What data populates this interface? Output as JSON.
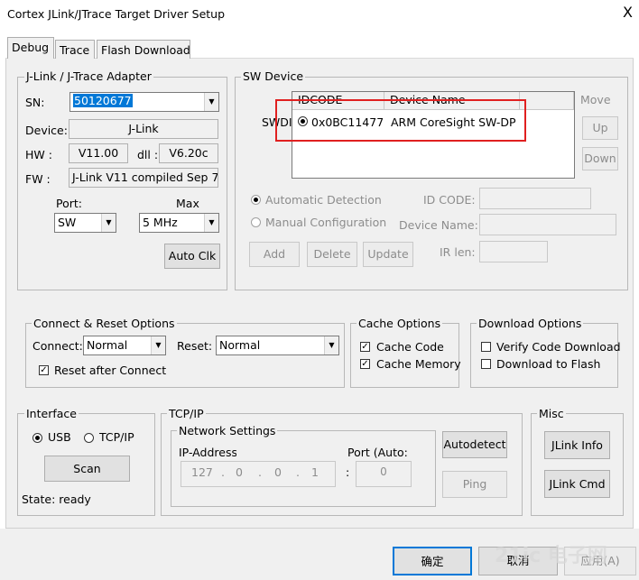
{
  "window": {
    "title": "Cortex JLink/JTrace Target Driver Setup",
    "close_glyph": "X"
  },
  "tabs": [
    "Debug",
    "Trace",
    "Flash Download"
  ],
  "adapter": {
    "title": "J-Link / J-Trace Adapter",
    "sn_label": "SN:",
    "sn_value": "50120677",
    "device_label": "Device:",
    "device_value": "J-Link",
    "hw_label": "HW :",
    "hw_value": "V11.00",
    "dll_label": "dll :",
    "dll_value": "V6.20c",
    "fw_label": "FW :",
    "fw_value": "J-Link V11 compiled Sep  7",
    "port_label": "Port:",
    "port_value": "SW",
    "max_label": "Max",
    "max_value": "5 MHz",
    "auto_clk": "Auto Clk"
  },
  "sw_device": {
    "title": "SW Device",
    "col_idcode": "IDCODE",
    "col_device_name": "Device Name",
    "row_label": "SWDI",
    "row_idcode": "0x0BC11477",
    "row_device": "ARM CoreSight SW-DP",
    "move_label": "Move",
    "up": "Up",
    "down": "Down",
    "auto_detect": "Automatic Detection",
    "manual_config": "Manual Configuration",
    "id_code_label": "ID CODE:",
    "device_name_label": "Device Name:",
    "ir_len_label": "IR len:",
    "add": "Add",
    "delete": "Delete",
    "update": "Update"
  },
  "connect_reset": {
    "title": "Connect & Reset Options",
    "connect_label": "Connect:",
    "connect_value": "Normal",
    "reset_label": "Reset:",
    "reset_value": "Normal",
    "reset_after_connect": "Reset after Connect"
  },
  "cache": {
    "title": "Cache Options",
    "cache_code": "Cache Code",
    "cache_memory": "Cache Memory"
  },
  "download": {
    "title": "Download Options",
    "verify": "Verify Code Download",
    "to_flash": "Download to Flash"
  },
  "interface": {
    "title": "Interface",
    "usb": "USB",
    "tcpip": "TCP/IP",
    "scan": "Scan",
    "state": "State: ready"
  },
  "tcpip": {
    "title": "TCP/IP",
    "network_settings": "Network Settings",
    "ip_label": "IP-Address",
    "port_label": "Port (Auto:",
    "ip1": "127",
    "ip2": "0",
    "ip3": "0",
    "ip4": "1",
    "port_value": "0",
    "autodetect": "Autodetect",
    "ping": "Ping"
  },
  "misc": {
    "title": "Misc",
    "jlink_info": "JLink Info",
    "jlink_cmd": "JLink Cmd"
  },
  "footer": {
    "ok": "确定",
    "cancel": "取消",
    "apply": "应用(A)",
    "watermark": "21ic 电子网"
  },
  "colors": {
    "highlight": "#0078d7",
    "red_box": "#e02020"
  }
}
